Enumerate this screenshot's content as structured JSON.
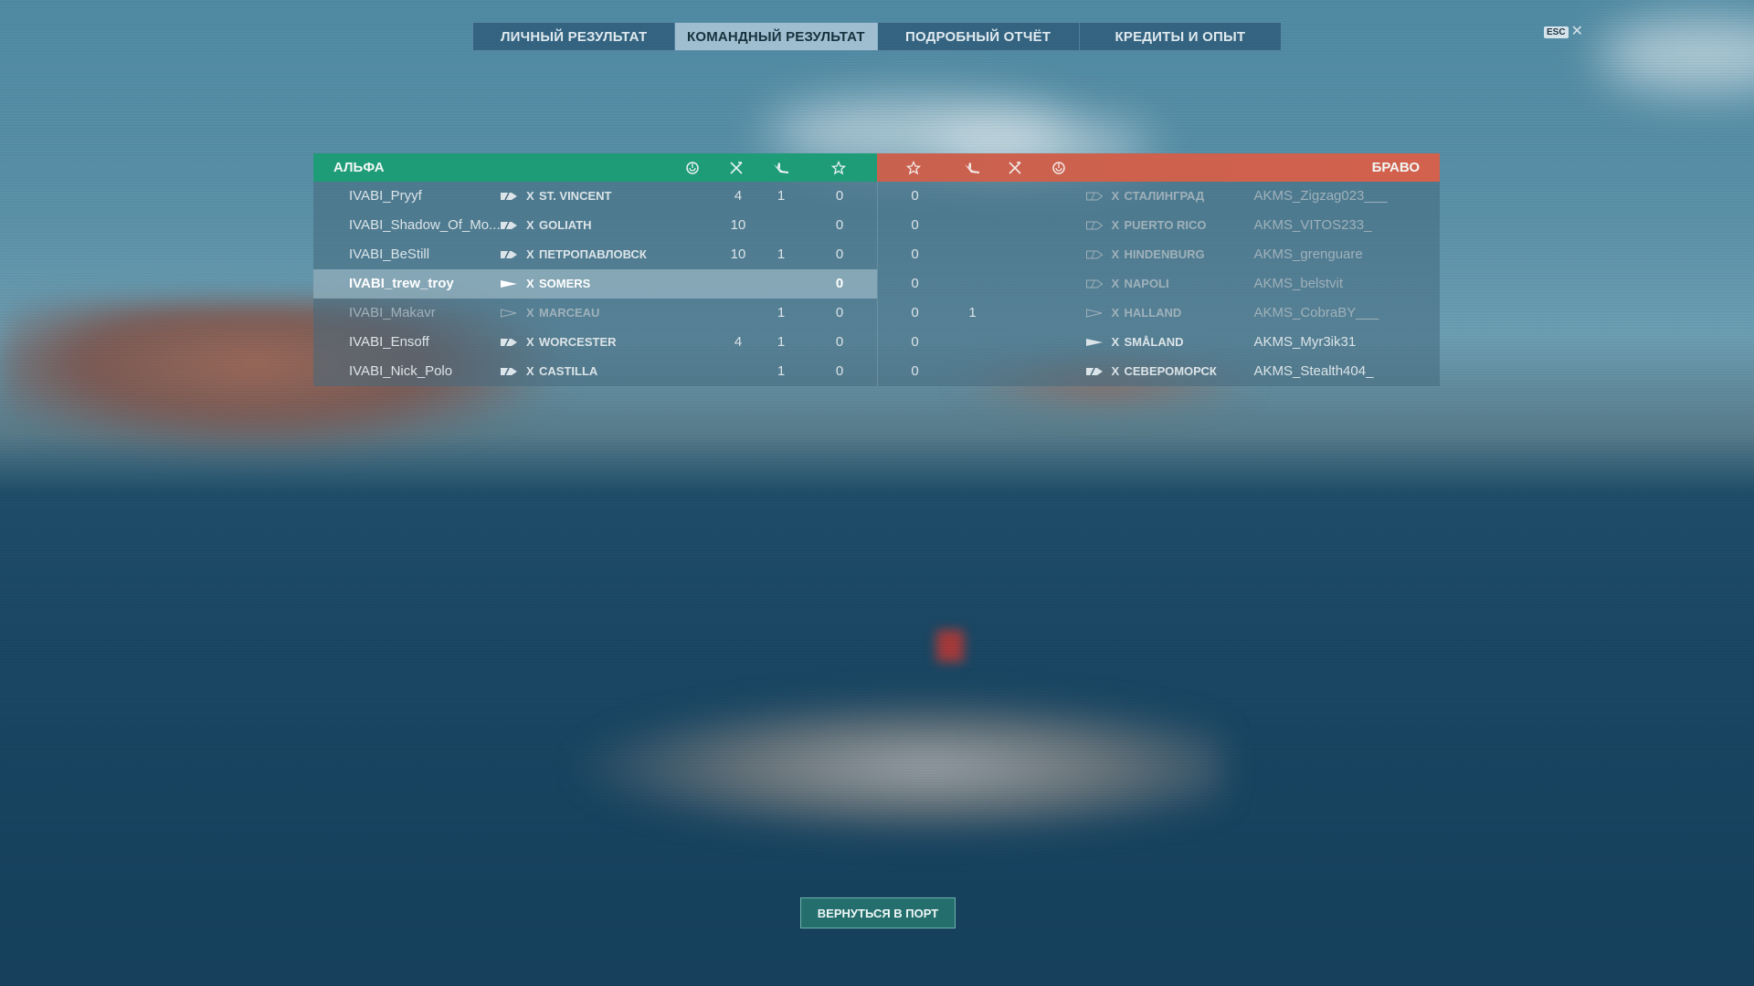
{
  "tabs": [
    {
      "label": "ЛИЧНЫЙ РЕЗУЛЬТАТ"
    },
    {
      "label": "КОМАНДНЫЙ РЕЗУЛЬТАТ"
    },
    {
      "label": "ПОДРОБНЫЙ ОТЧЁТ"
    },
    {
      "label": "КРЕДИТЫ И ОПЫТ"
    }
  ],
  "active_tab": 1,
  "esc": {
    "key": "ESC",
    "close": "✕"
  },
  "alpha": {
    "name": "АЛЬФА",
    "color": "#1e9c78",
    "players": [
      {
        "player": "IVABI_Pryyf",
        "tier": "X",
        "ship": "ST. VINCENT",
        "c1": "4",
        "c2": "1",
        "c3": "0"
      },
      {
        "player": "IVABI_Shadow_Of_Mo...",
        "tier": "X",
        "ship": "GOLIATH",
        "c1": "10",
        "c2": "",
        "c3": "0"
      },
      {
        "player": "IVABI_BeStill",
        "tier": "X",
        "ship": "ПЕТРОПАВЛОВСК",
        "c1": "10",
        "c2": "1",
        "c3": "0"
      },
      {
        "player": "IVABI_trew_troy",
        "tier": "X",
        "ship": "SOMERS",
        "c1": "",
        "c2": "",
        "c3": "0"
      },
      {
        "player": "IVABI_Makavr",
        "tier": "X",
        "ship": "MARCEAU",
        "c1": "",
        "c2": "1",
        "c3": "0"
      },
      {
        "player": "IVABI_Ensoff",
        "tier": "X",
        "ship": "WORCESTER",
        "c1": "4",
        "c2": "1",
        "c3": "0"
      },
      {
        "player": "IVABI_Nick_Polo",
        "tier": "X",
        "ship": "CASTILLA",
        "c1": "",
        "c2": "1",
        "c3": "0"
      }
    ]
  },
  "bravo": {
    "name": "БРАВО",
    "color": "#d2614d",
    "players": [
      {
        "c3": "0",
        "c2": "",
        "tier": "X",
        "ship": "СТАЛИНГРАД",
        "player": "AKMS_Zigzag023___"
      },
      {
        "c3": "0",
        "c2": "",
        "tier": "X",
        "ship": "PUERTO RICO",
        "player": "AKMS_VITOS233_"
      },
      {
        "c3": "0",
        "c2": "",
        "tier": "X",
        "ship": "HINDENBURG",
        "player": "AKMS_grenguare"
      },
      {
        "c3": "0",
        "c2": "",
        "tier": "X",
        "ship": "NAPOLI",
        "player": "AKMS_belstvit"
      },
      {
        "c3": "0",
        "c2": "1",
        "tier": "X",
        "ship": "HALLAND",
        "player": "AKMS_CobraBY___"
      },
      {
        "c3": "0",
        "c2": "",
        "tier": "X",
        "ship": "SMÅLAND",
        "player": "AKMS_Myr3ik31"
      },
      {
        "c3": "0",
        "c2": "",
        "tier": "X",
        "ship": "СЕВЕРОМОРСК",
        "player": "AKMS_Stealth404_"
      }
    ]
  },
  "back_button": {
    "label": "ВЕРНУТЬСЯ В ПОРТ"
  }
}
